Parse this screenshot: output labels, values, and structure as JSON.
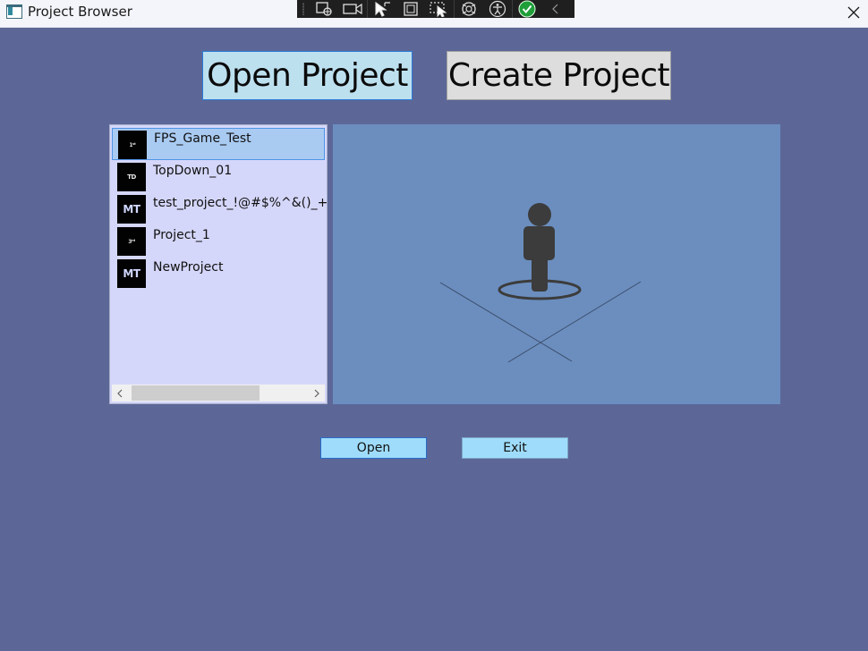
{
  "window": {
    "title": "Project Browser"
  },
  "tabs": {
    "open_label": "Open Project",
    "create_label": "Create Project"
  },
  "projects": [
    {
      "name": "FPS_Game_Test",
      "thumb_text": "1ˢᵗ",
      "selected": true
    },
    {
      "name": "TopDown_01",
      "thumb_text": "TD",
      "selected": false
    },
    {
      "name": "test_project_!@#$%^&()_+=-",
      "thumb_text": "MT",
      "selected": false
    },
    {
      "name": "Project_1",
      "thumb_text": "3ʳᵈ",
      "selected": false
    },
    {
      "name": "NewProject",
      "thumb_text": "MT",
      "selected": false
    }
  ],
  "actions": {
    "open_label": "Open",
    "exit_label": "Exit"
  },
  "colors": {
    "background": "#5c6797",
    "list_background": "#d5d7fa",
    "selected_item": "#a9cbf2",
    "preview_background": "#6b8ebf",
    "button_background": "#9fdcfb",
    "open_tab_background": "#bde0ef",
    "create_tab_background": "#dddddd"
  },
  "debug_toolbar_icons": [
    "select-element-icon",
    "video-capture-icon",
    "pointer-select-icon",
    "layout-adorner-icon",
    "track-focus-icon",
    "binding-failure-icon",
    "accessibility-icon",
    "checkmark-icon",
    "collapse-arrow-icon"
  ]
}
